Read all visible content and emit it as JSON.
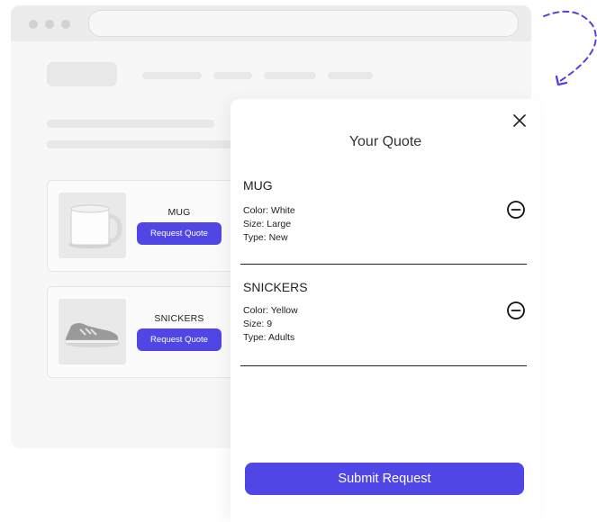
{
  "products": [
    {
      "name": "MUG",
      "button_label": "Request Quote"
    },
    {
      "name": "SNICKERS",
      "button_label": "Request Quote"
    }
  ],
  "quote_panel": {
    "title": "Your Quote",
    "items": [
      {
        "name": "MUG",
        "attributes": [
          "Color: White",
          "Size: Large",
          "Type: New"
        ]
      },
      {
        "name": "SNICKERS",
        "attributes": [
          "Color: Yellow",
          "Size: 9",
          "Type: Adults"
        ]
      }
    ],
    "submit_label": "Submit Request"
  },
  "colors": {
    "accent": "#4f46e5",
    "decoration": "#5b3fd6"
  },
  "icons": {
    "close": "close-icon",
    "remove": "minus-circle-icon",
    "arrow": "dashed-curved-arrow-icon"
  }
}
